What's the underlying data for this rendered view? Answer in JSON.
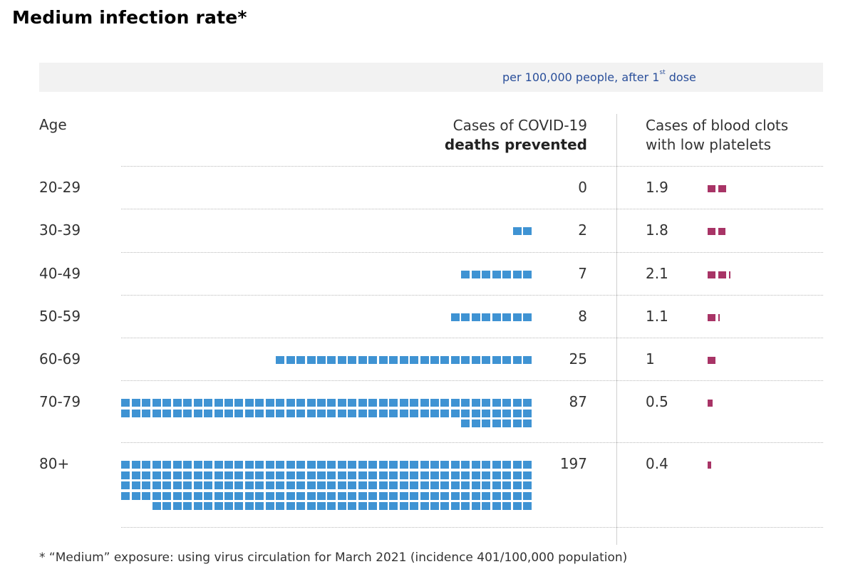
{
  "title": "Medium infection rate*",
  "banner": {
    "text": "per 100,000 people, after 1",
    "sup": "st",
    "suffix": " dose"
  },
  "columns": {
    "age": "Age",
    "deaths_line1": "Cases of COVID-19",
    "deaths_line2": "deaths prevented",
    "clots_line1": "Cases of blood clots",
    "clots_line2": "with low platelets"
  },
  "colors": {
    "deaths": "#3f93d3",
    "clots": "#a83466",
    "banner_text": "#2a4f9a"
  },
  "chart_data": {
    "type": "table",
    "title": "Medium infection rate*",
    "subtitle": "per 100,000 people, after 1st dose",
    "units_per_icon": 1,
    "series": [
      {
        "name": "Cases of COVID-19 deaths prevented",
        "values": [
          0,
          2,
          7,
          8,
          25,
          87,
          197
        ]
      },
      {
        "name": "Cases of blood clots with low platelets",
        "values": [
          1.9,
          1.8,
          2.1,
          1.1,
          1,
          0.5,
          0.4
        ]
      }
    ],
    "categories": [
      "20-29",
      "30-39",
      "40-49",
      "50-59",
      "60-69",
      "70-79",
      "80+"
    ],
    "value_labels": {
      "deaths": [
        "0",
        "2",
        "7",
        "8",
        "25",
        "87",
        "197"
      ],
      "clots": [
        "1.9",
        "1.8",
        "2.1",
        "1.1",
        "1",
        "0.5",
        "0.4"
      ]
    }
  },
  "footnote": "* “Medium” exposure: using virus circulation for March 2021 (incidence 401/100,000 population)"
}
